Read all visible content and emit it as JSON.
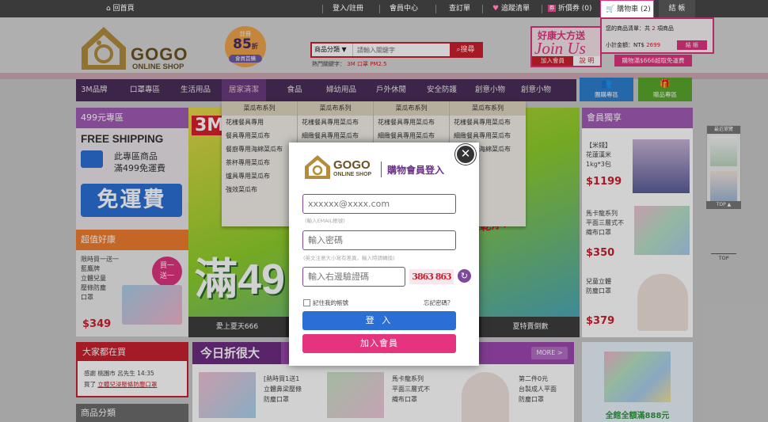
{
  "topbar": {
    "home": "回首頁",
    "login": "登入/註冊",
    "member": "會員中心",
    "orders": "查訂單",
    "wishlist": "追蹤清單",
    "coupon": "折價券 (0)",
    "cart": "購物車 (2)",
    "checkout": "結 帳"
  },
  "brand": {
    "name": "GOGO",
    "sub": "ONLINE SHOP"
  },
  "promo_badge": {
    "top": "註冊",
    "value": "85",
    "unit": "折",
    "bottom": "會員首購"
  },
  "search": {
    "category": "商品分類 ▼",
    "placeholder": "請輸入關鍵字",
    "button": "搜尋",
    "hot_label": "熱門關鍵字：",
    "hot": [
      "3M",
      "口罩",
      "PM2.5"
    ]
  },
  "join_banner": {
    "title": "好康大方送",
    "big": "Join Us",
    "left": "加入會員",
    "right": "說 明"
  },
  "mini_cart": {
    "line1_prefix": "您的商品清單：共",
    "count": "2",
    "line1_suffix": "項商品",
    "subtotal_label": "小計金額：NT$",
    "subtotal": "2699",
    "button": "結 帳",
    "note": "購物滿$666超取免運費"
  },
  "nav": {
    "items": [
      "3M品牌",
      "口罩專區",
      "生活用品",
      "居家清潔",
      "食品",
      "婦幼用品",
      "戶外休閒",
      "安全防護",
      "創意小物",
      "創意小物"
    ],
    "icon_buttons": [
      "團購專區",
      "贈品專區"
    ]
  },
  "dropdown": {
    "columns": [
      {
        "header": "菜瓜布系列",
        "rows": [
          "花樣餐具專用",
          "餐具專用菜瓜布",
          "餐廚專用海綿菜瓜布",
          "茶杯專用菜瓜布",
          "爐具專用菜瓜布",
          "強效菜瓜布"
        ]
      },
      {
        "header": "菜瓜布系列",
        "rows": [
          "花樣餐具專用菜瓜布",
          "細緻餐具專用菜瓜布",
          "",
          "",
          "",
          ""
        ]
      },
      {
        "header": "菜瓜布系列",
        "rows": [
          "花樣餐具專用菜瓜布",
          "細緻餐具專用菜瓜布",
          "",
          "",
          "",
          ""
        ]
      },
      {
        "header": "菜瓜布系列",
        "rows": [
          "花樣餐具專用菜瓜布",
          "細緻餐具專用菜瓜布",
          "餐廚專用海綿菜瓜布",
          "菜瓜布",
          "菜瓜布",
          "布"
        ]
      }
    ]
  },
  "left_col": {
    "zone499": "499元專區",
    "free_ship": "FREE SHIPPING",
    "free_line1": "此專區商品",
    "free_line2": "滿499免運費",
    "free_big": "免運費",
    "deal_title": "超值好康",
    "deal_desc": [
      "限時買一送一",
      "藍鷹牌",
      "立體兒童",
      "壓條防塵",
      "口罩"
    ],
    "deal_tag": [
      "買一",
      "送一"
    ],
    "deal_price": "$349",
    "buying_title": "大家都在買",
    "buying_line1": "感謝 桃園市 呂先生 14:35",
    "buying_line2_prefix": "買了",
    "buying_link": "立體兒浸壓條防塵口罩",
    "category_title": "商品分類"
  },
  "banner": {
    "left_caption": "愛上夏天666",
    "right_caption": "夏特賣倒數",
    "big": "滿49",
    "tag": "3M",
    "slogan": "點擊乾淨!"
  },
  "today": {
    "title": "今日折很大",
    "more": "MORE >",
    "items": [
      {
        "text": [
          "[熱時買1送1",
          "立體鼻梁壓條",
          "防塵口罩"
        ]
      },
      {
        "text": [
          "馬卡龍系列",
          "平面三層式不",
          "織布口罩"
        ]
      },
      {
        "text": [
          "第二件0元",
          "台製成人平面",
          "防塵口罩"
        ]
      }
    ]
  },
  "right_col": {
    "title": "會員獨享",
    "items": [
      {
        "text": [
          "【米錢】",
          "花蓮漢米",
          "1kg*3包"
        ],
        "price": "$1199"
      },
      {
        "text": [
          "馬卡龍系列",
          "平面三層式不",
          "織布口罩"
        ],
        "price": "$350"
      },
      {
        "text": [
          "兒童立體",
          "防塵口罩"
        ],
        "price": "$379"
      }
    ],
    "bottom_promo": "全館全額滿888元"
  },
  "far_right": {
    "recent": "最近瀏覽",
    "top": "TOP ▲",
    "top2": "TOP"
  },
  "modal": {
    "brand": "GOGO",
    "brand_sub": "ONLINE SHOP",
    "title": "購物會員登入",
    "email_placeholder": "xxxxxx@xxxx.com",
    "email_hint": "(輸入EMAIL帳號)",
    "pw_placeholder": "輸入密碼",
    "pw_hint": "(英文注意大小寫有差異，輸入時請轉換)",
    "captcha_placeholder": "輸入右邊驗證碼",
    "captcha": "3863 863",
    "remember": "記住我的帳號",
    "forgot": "忘記密碼？",
    "login": "登 入",
    "register": "加入會員"
  },
  "colors": {
    "purple": "#4a2e59",
    "pink": "#e4347f",
    "blue": "#2b6fd6",
    "red": "#c8202e",
    "gold": "#b38c3c"
  }
}
